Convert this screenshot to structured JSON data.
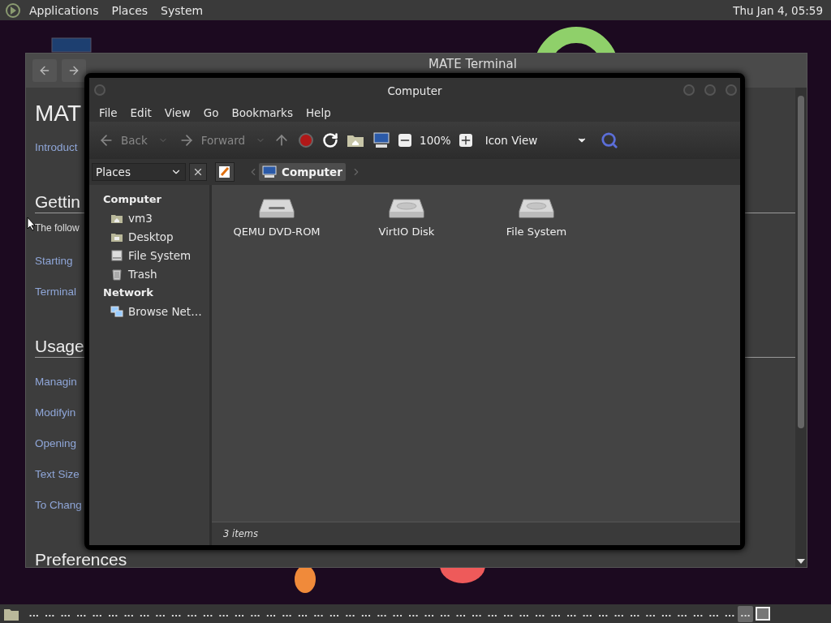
{
  "top_panel": {
    "menus": [
      "Applications",
      "Places",
      "System"
    ],
    "clock": "Thu Jan  4, 05:59"
  },
  "help_window": {
    "title": "MATE Terminal",
    "content": [
      {
        "kind": "heading",
        "text": "MAT"
      },
      {
        "kind": "link",
        "text": "Introduct"
      },
      {
        "kind": "section",
        "text": "Gettin"
      },
      {
        "kind": "paragraph",
        "text": "The follow"
      },
      {
        "kind": "link",
        "text": "Starting"
      },
      {
        "kind": "link",
        "text": "Terminal"
      },
      {
        "kind": "section",
        "text": "Usage"
      },
      {
        "kind": "link",
        "text": "Managin"
      },
      {
        "kind": "link",
        "text": "Modifyin"
      },
      {
        "kind": "link",
        "text": "Opening"
      },
      {
        "kind": "link",
        "text": "Text Size"
      },
      {
        "kind": "link",
        "text": "To Chang"
      },
      {
        "kind": "section",
        "text": "Preferences"
      }
    ]
  },
  "file_manager": {
    "title": "Computer",
    "menu": [
      "File",
      "Edit",
      "View",
      "Go",
      "Bookmarks",
      "Help"
    ],
    "toolbar": {
      "back": "Back",
      "forward": "Forward",
      "zoom": "100%",
      "view": "Icon View"
    },
    "sidebar": {
      "selector": "Places",
      "sections": [
        {
          "title": "Computer",
          "items": [
            {
              "label": "vm3",
              "kind": "home"
            },
            {
              "label": "Desktop",
              "kind": "desktop"
            },
            {
              "label": "File System",
              "kind": "drive"
            },
            {
              "label": "Trash",
              "kind": "trash"
            }
          ]
        },
        {
          "title": "Network",
          "items": [
            {
              "label": "Browse Net…",
              "kind": "network"
            }
          ]
        }
      ]
    },
    "path": {
      "current": "Computer"
    },
    "items": [
      {
        "label": "QEMU DVD-ROM",
        "kind": "optical"
      },
      {
        "label": "VirtIO Disk",
        "kind": "disk"
      },
      {
        "label": "File System",
        "kind": "disk"
      }
    ],
    "status": "3 items"
  },
  "taskbar": {
    "buttons": [
      {
        "label": "...",
        "selected": false
      },
      {
        "label": "...",
        "selected": false
      },
      {
        "label": "...",
        "selected": false
      },
      {
        "label": "...",
        "selected": false
      },
      {
        "label": "...",
        "selected": false
      },
      {
        "label": "...",
        "selected": false
      },
      {
        "label": "...",
        "selected": false
      },
      {
        "label": "...",
        "selected": false
      },
      {
        "label": "...",
        "selected": false
      },
      {
        "label": "...",
        "selected": false
      },
      {
        "label": "...",
        "selected": false
      },
      {
        "label": "...",
        "selected": false
      },
      {
        "label": "...",
        "selected": false
      },
      {
        "label": "...",
        "selected": false
      },
      {
        "label": "...",
        "selected": false
      },
      {
        "label": "...",
        "selected": false
      },
      {
        "label": "...",
        "selected": false
      },
      {
        "label": "...",
        "selected": false
      },
      {
        "label": "...",
        "selected": false
      },
      {
        "label": "...",
        "selected": false
      },
      {
        "label": "...",
        "selected": false
      },
      {
        "label": "...",
        "selected": false
      },
      {
        "label": "...",
        "selected": false
      },
      {
        "label": "...",
        "selected": false
      },
      {
        "label": "...",
        "selected": false
      },
      {
        "label": "...",
        "selected": false
      },
      {
        "label": "...",
        "selected": false
      },
      {
        "label": "...",
        "selected": false
      },
      {
        "label": "...",
        "selected": false
      },
      {
        "label": "...",
        "selected": false
      },
      {
        "label": "...",
        "selected": false
      },
      {
        "label": "...",
        "selected": false
      },
      {
        "label": "...",
        "selected": false
      },
      {
        "label": "...",
        "selected": false
      },
      {
        "label": "...",
        "selected": false
      },
      {
        "label": "...",
        "selected": false
      },
      {
        "label": "...",
        "selected": false
      },
      {
        "label": "...",
        "selected": false
      },
      {
        "label": "...",
        "selected": false
      },
      {
        "label": "...",
        "selected": false
      },
      {
        "label": "...",
        "selected": false
      },
      {
        "label": "...",
        "selected": false
      },
      {
        "label": "...",
        "selected": false
      },
      {
        "label": "...",
        "selected": false
      },
      {
        "label": "...",
        "selected": false
      },
      {
        "label": "...",
        "selected": true
      }
    ]
  }
}
